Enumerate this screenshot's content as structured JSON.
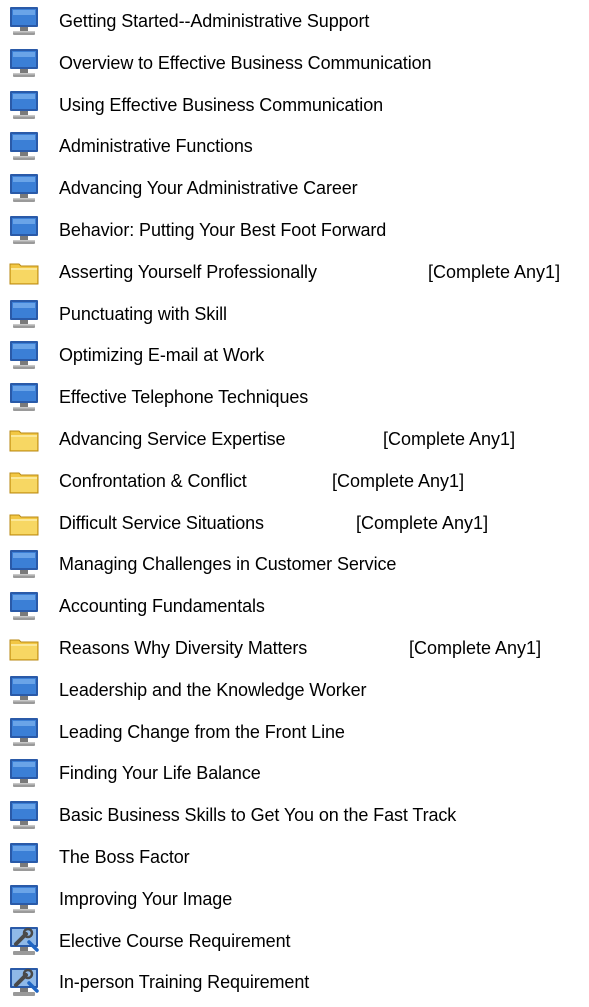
{
  "items": [
    {
      "type": "course",
      "icon": "monitor-icon",
      "label": "Getting Started--Administrative Support",
      "requirement": ""
    },
    {
      "type": "course",
      "icon": "monitor-icon",
      "label": "Overview to Effective Business Communication",
      "requirement": ""
    },
    {
      "type": "course",
      "icon": "monitor-icon",
      "label": "Using Effective Business Communication",
      "requirement": ""
    },
    {
      "type": "course",
      "icon": "monitor-icon",
      "label": "Administrative Functions",
      "requirement": ""
    },
    {
      "type": "course",
      "icon": "monitor-icon",
      "label": "Advancing Your Administrative Career",
      "requirement": ""
    },
    {
      "type": "course",
      "icon": "monitor-icon",
      "label": "Behavior: Putting Your Best Foot Forward",
      "requirement": ""
    },
    {
      "type": "folder",
      "icon": "folder-icon",
      "label": "Asserting Yourself Professionally",
      "requirement": "[Complete Any1]"
    },
    {
      "type": "course",
      "icon": "monitor-icon",
      "label": "Punctuating with Skill",
      "requirement": ""
    },
    {
      "type": "course",
      "icon": "monitor-icon",
      "label": "Optimizing E-mail at Work",
      "requirement": ""
    },
    {
      "type": "course",
      "icon": "monitor-icon",
      "label": "Effective Telephone Techniques",
      "requirement": ""
    },
    {
      "type": "folder",
      "icon": "folder-icon",
      "label": "Advancing Service Expertise",
      "requirement": "[Complete Any1]"
    },
    {
      "type": "folder",
      "icon": "folder-icon",
      "label": "Confrontation & Conflict",
      "requirement": "[Complete Any1]"
    },
    {
      "type": "folder",
      "icon": "folder-icon",
      "label": "Difficult Service Situations",
      "requirement": "[Complete Any1]"
    },
    {
      "type": "course",
      "icon": "monitor-icon",
      "label": "Managing Challenges in Customer Service",
      "requirement": ""
    },
    {
      "type": "course",
      "icon": "monitor-icon",
      "label": "Accounting Fundamentals",
      "requirement": ""
    },
    {
      "type": "folder",
      "icon": "folder-icon",
      "label": "Reasons Why Diversity Matters",
      "requirement": "[Complete Any1]"
    },
    {
      "type": "course",
      "icon": "monitor-icon",
      "label": "Leadership and the Knowledge Worker",
      "requirement": ""
    },
    {
      "type": "course",
      "icon": "monitor-icon",
      "label": "Leading Change from the Front Line",
      "requirement": ""
    },
    {
      "type": "course",
      "icon": "monitor-icon",
      "label": "Finding Your Life Balance",
      "requirement": ""
    },
    {
      "type": "course",
      "icon": "monitor-icon",
      "label": "Basic Business Skills to Get You on the Fast Track",
      "requirement": ""
    },
    {
      "type": "course",
      "icon": "monitor-icon",
      "label": "The Boss Factor",
      "requirement": ""
    },
    {
      "type": "course",
      "icon": "monitor-icon",
      "label": "Improving Your Image",
      "requirement": ""
    },
    {
      "type": "requirement",
      "icon": "requirement-tool-icon",
      "label": "Elective Course Requirement",
      "requirement": ""
    },
    {
      "type": "requirement",
      "icon": "requirement-tool-icon",
      "label": "In-person Training Requirement",
      "requirement": ""
    }
  ],
  "colors": {
    "monitor_screen": "#3b7fd6",
    "monitor_frame": "#2a5aa8",
    "folder": "#f2c744",
    "folder_edge": "#b88a14"
  }
}
